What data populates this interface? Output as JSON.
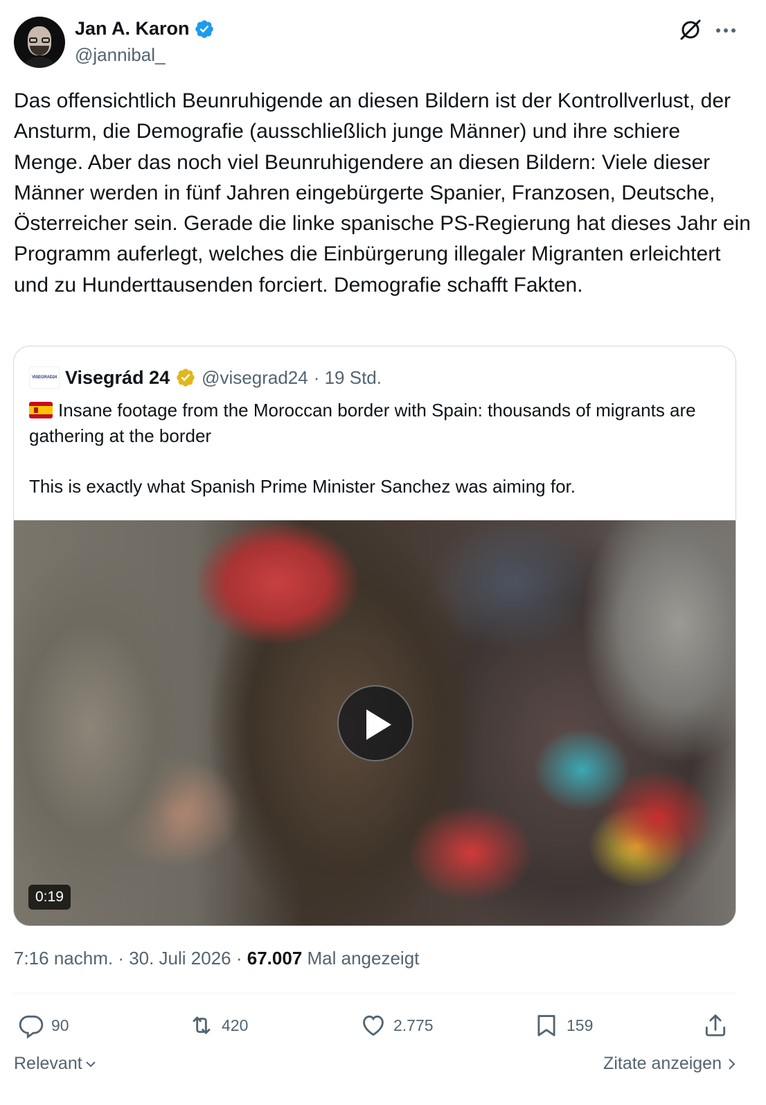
{
  "author": {
    "name": "Jan A. Karon",
    "handle": "@jannibal_"
  },
  "tweet": {
    "text": "Das offensichtlich Beunruhigende an diesen Bildern ist der Kontrollverlust, der Ansturm, die Demografie (ausschließlich junge Männer) und ihre schiere Menge. Aber das noch viel Beunruhigendere an diesen Bildern: Viele dieser Männer werden in fünf Jahren eingebürgerte Spanier, Franzosen, Deutsche, Österreicher sein. Gerade die linke spanische PS-Regierung hat dieses Jahr ein Programm auferlegt, welches die Einbürgerung illegaler Migranten erleichtert und zu Hunderttausenden forciert. Demografie schafft Fakten."
  },
  "quote": {
    "logo_text": "VISEGRAD24",
    "name": "Visegrád 24",
    "handle": "@visegrad24",
    "time": "· 19 Std.",
    "line1": "Insane footage from the Moroccan border with Spain: thousands of migrants are gathering at the border",
    "line2": "This is exactly what Spanish Prime Minister Sanchez was aiming for.",
    "video_duration": "0:19"
  },
  "meta": {
    "time": "7:16 nachm. · 30. Juli 2026 · ",
    "views": "67.007",
    "views_label": " Mal angezeigt"
  },
  "actions": {
    "replies": "90",
    "reposts": "420",
    "likes": "2.775",
    "bookmarks": "159"
  },
  "footer": {
    "sort_label": "Relevant",
    "quotes_label": "Zitate anzeigen"
  },
  "colors": {
    "verified_blue": "#1d9bf0",
    "gold": "#e2b719",
    "text": "#0f1419",
    "secondary": "#536471"
  }
}
